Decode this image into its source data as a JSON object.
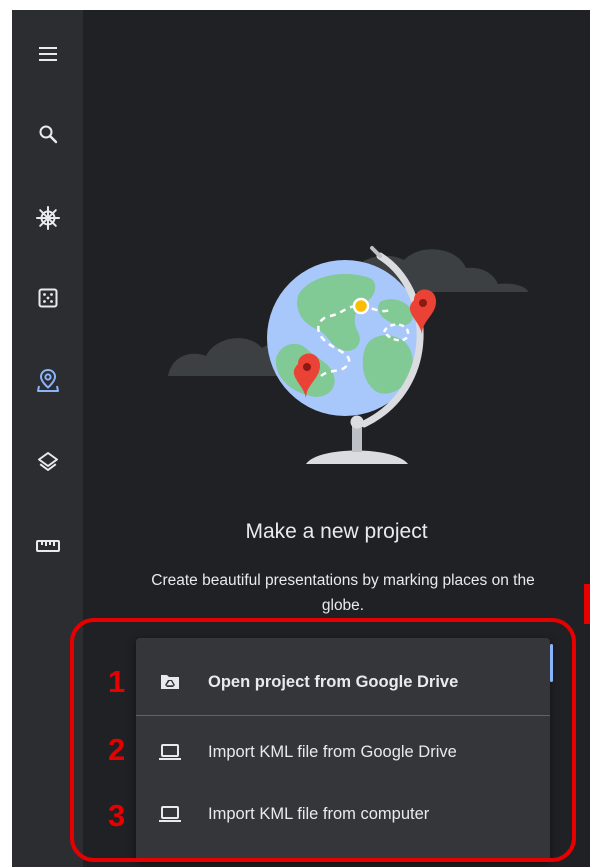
{
  "sidebar": {
    "items": [
      {
        "icon": "menu-icon",
        "active": false
      },
      {
        "icon": "search-icon",
        "active": false
      },
      {
        "icon": "voyager-helm-icon",
        "active": false
      },
      {
        "icon": "dice-icon",
        "active": false
      },
      {
        "icon": "projects-pin-icon",
        "active": true
      },
      {
        "icon": "layers-icon",
        "active": false
      },
      {
        "icon": "ruler-icon",
        "active": false
      }
    ]
  },
  "empty_state": {
    "title": "Make a new project",
    "description": "Create beautiful presentations by marking places on the globe.",
    "illustration_icon": "globe-illustration"
  },
  "menu": {
    "items": [
      {
        "label": "Open project from Google Drive",
        "icon": "drive-folder-icon",
        "badge": "1"
      },
      {
        "label": "Import KML file from Google Drive",
        "icon": "laptop-icon",
        "badge": "2"
      },
      {
        "label": "Import KML file from computer",
        "icon": "laptop-icon",
        "badge": "3"
      }
    ]
  },
  "colors": {
    "background": "#202124",
    "sidebar": "#2c2d31",
    "menu_surface": "#35363a",
    "text": "#e8eaed",
    "accent": "#8ab4f8",
    "annotation_red": "#e60000"
  }
}
